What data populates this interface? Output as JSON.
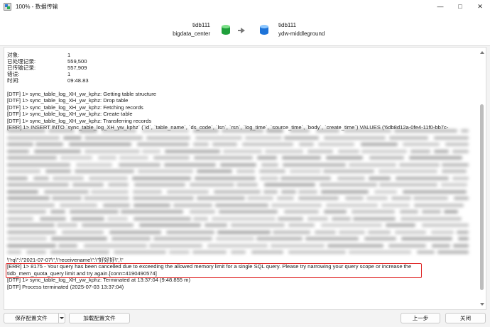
{
  "window": {
    "title": "100% - 数据传输",
    "app_icon": "navicat-transfer-icon"
  },
  "header": {
    "source": {
      "connection": "tidb111",
      "database": "bigdata_center",
      "icon_color": "#1f9f3b"
    },
    "target": {
      "connection": "tidb111",
      "database": "ydw-middleground",
      "icon_color": "#1e73d8"
    }
  },
  "stats": [
    {
      "label": "对象:",
      "value": "1"
    },
    {
      "label": "已处理记录:",
      "value": "559,500"
    },
    {
      "label": "已传输记录:",
      "value": "557,909"
    },
    {
      "label": "错误:",
      "value": "1"
    },
    {
      "label": "时间:",
      "value": "09:48.83"
    }
  ],
  "log_top": [
    "[DTF] 1> sync_table_log_XH_yw_kphz: Getting table structure",
    "[DTF] 1> sync_table_log_XH_yw_kphz: Drop table",
    "[DTF] 1> sync_table_log_XH_yw_kphz: Fetching records",
    "[DTF] 1> sync_table_log_XH_yw_kphz: Create table",
    "[DTF] 1> sync_table_log_XH_yw_kphz: Transferring records",
    "[ERR] 1> INSERT INTO `sync_table_log_XH_yw_kphz` (`id`, `table_name`, `ds_code`, `lsn`, `rsn`, `log_time`, `source_time`, `body`, `create_time`) VALUES ('6db8d12a-0fe4-11f0-bb7c-"
  ],
  "log_bottom": [
    "\\\"rq\\\":\\\"2021-07-07\\\",\\\"receivename\\\":\\\"好好好\\\",\\\"",
    "[ERR] 1> 8175 - Your query has been cancelled due to exceeding the allowed memory limit for a single SQL query. Please try narrowing your query scope or increase the",
    "tidb_mem_quota_query limit and try again.[conn=4190490574]",
    "[DTF] 1> sync_table_log_XH_yw_kphz: Terminated at 13:37:04 (9:48.855 m)",
    "[DTF] Process terminated (2025-07-03 13:37:04)"
  ],
  "buttons": {
    "save": "保存配置文件",
    "load": "加载配置文件",
    "prev": "上一步",
    "close": "关闭"
  },
  "colors": {
    "error_highlight": "#e02b2b"
  }
}
